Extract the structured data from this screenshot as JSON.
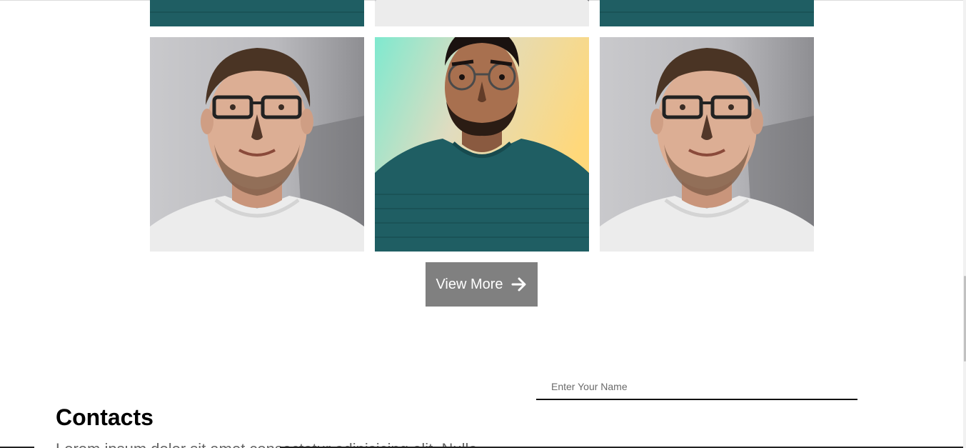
{
  "gallery": {
    "photos": [
      {
        "subject": "man-green-shirt",
        "row": "top-partial"
      },
      {
        "subject": "man-white-shirt",
        "row": "top-partial"
      },
      {
        "subject": "man-green-shirt",
        "row": "top-partial"
      },
      {
        "subject": "man-white-shirt",
        "row": "main"
      },
      {
        "subject": "man-green-shirt",
        "row": "main"
      },
      {
        "subject": "man-white-shirt",
        "row": "main"
      }
    ],
    "view_more_label": "View More",
    "view_more_icon": "arrow-right-icon"
  },
  "contacts": {
    "title": "Contacts",
    "intro_text": "Lorem ipsum dolor sit amet consectetur adipisicing elit. Nulla"
  },
  "form": {
    "name_placeholder": "Enter Your Name",
    "name_value": ""
  },
  "colors": {
    "button_bg": "#808080",
    "button_text": "#ffffff",
    "input_underline": "#111111"
  }
}
